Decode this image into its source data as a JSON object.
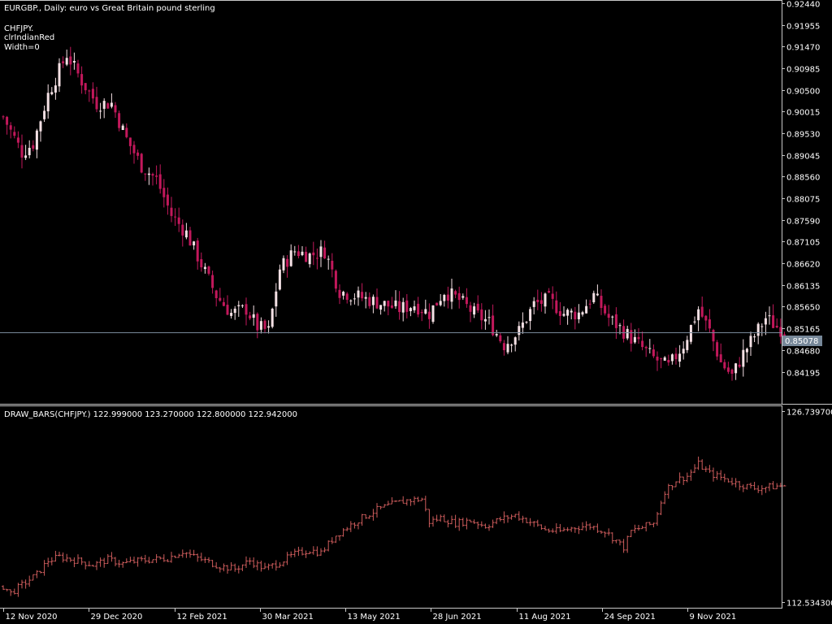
{
  "main_chart": {
    "header": "EURGBP., Daily:  euro vs Great Britain pound sterling",
    "indicator_label": "CHFJPY.",
    "color_label": "clrIndianRed",
    "width_label": "Width=0",
    "price_label": "0.85078"
  },
  "sub_chart": {
    "header": "DRAW_BARS(CHFJPY.) 122.999000 123.270000 122.800000 122.942000"
  },
  "colors": {
    "background": "#000000",
    "axis": "#c8c8c8",
    "bull": "#f4e0e4",
    "bear": "#c2185b",
    "indicator_bars": "#cd5c5c",
    "price_line": "#778899"
  },
  "chart_data": [
    {
      "type": "candlestick",
      "title": "EURGBP., Daily:  euro vs Great Britain pound sterling",
      "ylim": [
        0.8395,
        0.9244
      ],
      "y_ticks": [
        "0.92440",
        "0.91955",
        "0.91470",
        "0.90985",
        "0.90500",
        "0.90015",
        "0.89530",
        "0.89045",
        "0.88560",
        "0.88075",
        "0.87590",
        "0.87105",
        "0.86620",
        "0.86135",
        "0.85650",
        "0.85165",
        "0.84680",
        "0.84195"
      ],
      "price_line": 0.85078,
      "x_dates": [
        "12 Nov 2020",
        "29 Dec 2020",
        "12 Feb 2021",
        "30 Mar 2021",
        "13 May 2021",
        "28 Jun 2021",
        "11 Aug 2021",
        "24 Sep 2021",
        "9 Nov 2021"
      ],
      "close_path": [
        [
          0,
          0.899
        ],
        [
          5,
          0.891
        ],
        [
          8,
          0.893
        ],
        [
          12,
          0.904
        ],
        [
          17,
          0.913
        ],
        [
          21,
          0.907
        ],
        [
          25,
          0.902
        ],
        [
          29,
          0.902
        ],
        [
          33,
          0.894
        ],
        [
          37,
          0.888
        ],
        [
          41,
          0.885
        ],
        [
          45,
          0.877
        ],
        [
          49,
          0.873
        ],
        [
          53,
          0.866
        ],
        [
          57,
          0.859
        ],
        [
          61,
          0.855
        ],
        [
          65,
          0.856
        ],
        [
          68,
          0.852
        ],
        [
          71,
          0.851
        ],
        [
          74,
          0.865
        ],
        [
          78,
          0.869
        ],
        [
          82,
          0.868
        ],
        [
          86,
          0.869
        ],
        [
          90,
          0.86
        ],
        [
          94,
          0.859
        ],
        [
          98,
          0.858
        ],
        [
          102,
          0.857
        ],
        [
          106,
          0.856
        ],
        [
          110,
          0.857
        ],
        [
          114,
          0.855
        ],
        [
          118,
          0.86
        ],
        [
          122,
          0.858
        ],
        [
          126,
          0.855
        ],
        [
          130,
          0.853
        ],
        [
          134,
          0.848
        ],
        [
          138,
          0.851
        ],
        [
          142,
          0.857
        ],
        [
          146,
          0.858
        ],
        [
          150,
          0.855
        ],
        [
          154,
          0.855
        ],
        [
          158,
          0.859
        ],
        [
          162,
          0.854
        ],
        [
          166,
          0.851
        ],
        [
          170,
          0.848
        ],
        [
          174,
          0.845
        ],
        [
          178,
          0.843
        ],
        [
          182,
          0.848
        ],
        [
          186,
          0.856
        ],
        [
          189,
          0.851
        ],
        [
          192,
          0.844
        ],
        [
          195,
          0.841
        ],
        [
          198,
          0.846
        ],
        [
          201,
          0.85
        ],
        [
          204,
          0.854
        ],
        [
          207,
          0.852
        ],
        [
          209,
          0.851
        ]
      ]
    },
    {
      "type": "bar",
      "title": "DRAW_BARS(CHFJPY.)",
      "ylim": [
        112.5343,
        126.7397
      ],
      "y_ticks": [
        "126.739700",
        "112.534300"
      ],
      "values": [
        122.999,
        123.27,
        122.8,
        122.942
      ],
      "close_path": [
        [
          0,
          113.7
        ],
        [
          2,
          113.2
        ],
        [
          6,
          114.0
        ],
        [
          9,
          114.6
        ],
        [
          12,
          115.6
        ],
        [
          15,
          115.9
        ],
        [
          20,
          115.6
        ],
        [
          24,
          115.3
        ],
        [
          28,
          115.7
        ],
        [
          32,
          115.4
        ],
        [
          36,
          115.6
        ],
        [
          40,
          115.7
        ],
        [
          44,
          115.8
        ],
        [
          48,
          116.3
        ],
        [
          51,
          115.9
        ],
        [
          54,
          115.6
        ],
        [
          58,
          115.2
        ],
        [
          62,
          115.0
        ],
        [
          66,
          115.6
        ],
        [
          70,
          115.0
        ],
        [
          74,
          115.5
        ],
        [
          78,
          116.1
        ],
        [
          82,
          116.4
        ],
        [
          85,
          116.2
        ],
        [
          89,
          117.5
        ],
        [
          92,
          118.1
        ],
        [
          96,
          118.8
        ],
        [
          100,
          119.4
        ],
        [
          104,
          119.8
        ],
        [
          108,
          120.1
        ],
        [
          112,
          120.2
        ],
        [
          114,
          118.5
        ],
        [
          117,
          118.8
        ],
        [
          121,
          118.4
        ],
        [
          125,
          118.6
        ],
        [
          129,
          118.2
        ],
        [
          133,
          118.7
        ],
        [
          137,
          119.0
        ],
        [
          141,
          118.5
        ],
        [
          145,
          117.9
        ],
        [
          149,
          117.8
        ],
        [
          153,
          118.1
        ],
        [
          157,
          118.2
        ],
        [
          161,
          117.8
        ],
        [
          164,
          117.1
        ],
        [
          166,
          116.6
        ],
        [
          168,
          117.8
        ],
        [
          171,
          118.1
        ],
        [
          174,
          118.4
        ],
        [
          177,
          120.8
        ],
        [
          180,
          121.6
        ],
        [
          183,
          121.9
        ],
        [
          186,
          122.8
        ],
        [
          189,
          122.1
        ],
        [
          193,
          121.7
        ],
        [
          197,
          121.3
        ],
        [
          201,
          121.0
        ],
        [
          205,
          121.1
        ],
        [
          209,
          121.2
        ]
      ]
    }
  ]
}
